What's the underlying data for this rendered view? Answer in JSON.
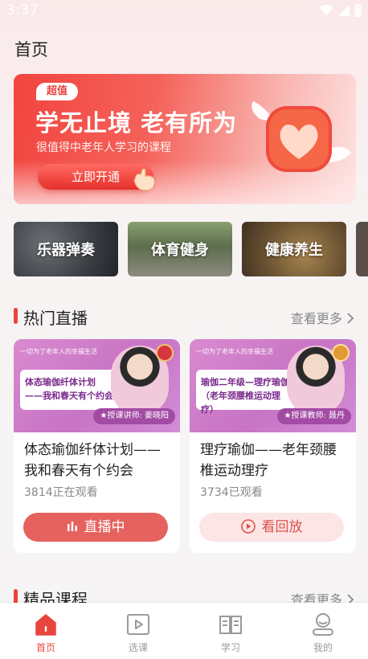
{
  "status_bar": {
    "time": "3:37"
  },
  "page": {
    "title": "首页"
  },
  "banner": {
    "badge": "超值",
    "title": "学无止境 老有所为",
    "subtitle": "很值得中老年人学习的课程",
    "button_label": "立即开通",
    "accent_color": "#e8453f"
  },
  "categories": [
    {
      "label": "乐器弹奏"
    },
    {
      "label": "体育健身"
    },
    {
      "label": "健康养生"
    }
  ],
  "live_section": {
    "title": "热门直播",
    "more": "查看更多"
  },
  "live_cards": [
    {
      "thumb_top": "一切为了老年人的幸福生活",
      "thumb_line1": "体态瑜伽纤体计划",
      "thumb_line2": "——我和春天有个约会",
      "thumb_teacher": "★授课讲师: 姜晓阳",
      "title": "体态瑜伽纤体计划——我和春天有个约会",
      "viewers": "3814正在观看",
      "button": "直播中",
      "button_icon": "live-bars-icon"
    },
    {
      "thumb_top": "一切为了老年人的幸福生活",
      "thumb_line1": "瑜伽二年级—理疗瑜伽",
      "thumb_line2": "（老年颈腰椎运动理疗）",
      "thumb_teacher": "★授课教师: 聂丹",
      "title": "理疗瑜伽——老年颈腰椎运动理疗",
      "viewers": "3734已观看",
      "button": "看回放",
      "button_icon": "play-circle-icon"
    }
  ],
  "courses_section": {
    "title": "精品课程",
    "more": "查看更多"
  },
  "bottom_nav": [
    {
      "label": "首页",
      "icon": "home-icon",
      "active": true
    },
    {
      "label": "选课",
      "icon": "video-icon",
      "active": false
    },
    {
      "label": "学习",
      "icon": "book-icon",
      "active": false
    },
    {
      "label": "我的",
      "icon": "user-icon",
      "active": false
    }
  ]
}
